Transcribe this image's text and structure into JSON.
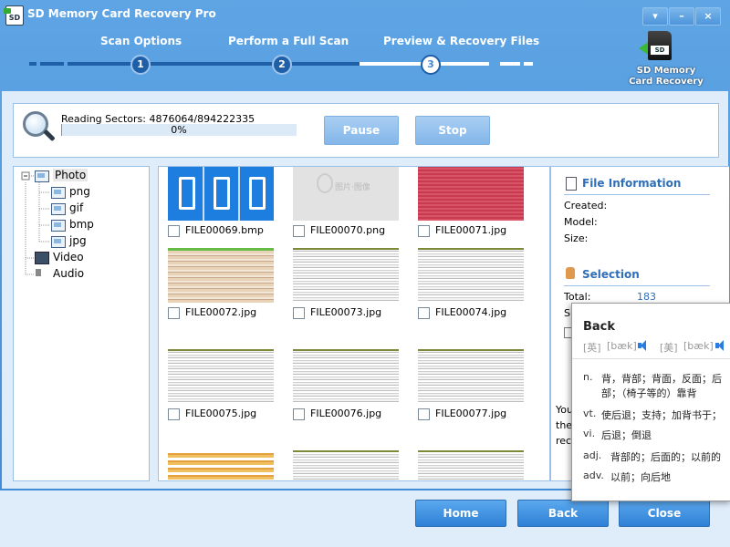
{
  "window": {
    "title": "SD Memory Card Recovery Pro",
    "controls": {
      "menu": "▾",
      "minimize": "–",
      "close": "×"
    }
  },
  "steps": [
    {
      "label": "Scan Options",
      "number": "1",
      "state": "done"
    },
    {
      "label": "Perform a Full Scan",
      "number": "2",
      "state": "done"
    },
    {
      "label": "Preview & Recovery Files",
      "number": "3",
      "state": "current"
    }
  ],
  "logo": {
    "line1": "SD Memory",
    "line2": "Card Recovery",
    "card_label": "SD"
  },
  "scan": {
    "reading_label": "Reading Sectors: 4876064/894222335",
    "progress_text": "0%",
    "progress_fraction": 0.005,
    "pause_label": "Pause",
    "stop_label": "Stop"
  },
  "tree": {
    "photo": "Photo",
    "png": "png",
    "gif": "gif",
    "bmp": "bmp",
    "jpg": "jpg",
    "video": "Video",
    "audio": "Audio"
  },
  "files": [
    {
      "name": "FILE00069.bmp",
      "kind": "bmp-blue"
    },
    {
      "name": "FILE00070.png",
      "kind": "png-gray"
    },
    {
      "name": "FILE00071.jpg",
      "kind": "jpg-red"
    },
    {
      "name": "FILE00072.jpg",
      "kind": "jpg-beige"
    },
    {
      "name": "FILE00073.jpg",
      "kind": "jpg-lines"
    },
    {
      "name": "FILE00074.jpg",
      "kind": "jpg-lines"
    },
    {
      "name": "FILE00075.jpg",
      "kind": "jpg-lines"
    },
    {
      "name": "FILE00076.jpg",
      "kind": "jpg-lines"
    },
    {
      "name": "FILE00077.jpg",
      "kind": "jpg-lines"
    },
    {
      "name": "",
      "kind": "jpg-yellow"
    },
    {
      "name": "",
      "kind": "jpg-lines"
    },
    {
      "name": "",
      "kind": "jpg-lines"
    }
  ],
  "info": {
    "file_info_title": "File Information",
    "created_label": "Created:",
    "model_label": "Model:",
    "size_label": "Size:",
    "selection_title": "Selection",
    "total_label": "Total:",
    "total_value": "183",
    "s_label": "S",
    "footer_line1": "You",
    "footer_line2": "the",
    "footer_line3": "rec"
  },
  "bottom": {
    "home": "Home",
    "back": "Back",
    "close": "Close"
  },
  "dictionary": {
    "word": "Back",
    "uk_tag": "[英]",
    "uk_phon": "[bæk]",
    "us_tag": "[美]",
    "us_phon": "[bæk]",
    "entries": [
      {
        "pos": "n.",
        "def": "背，背部；背面，反面；后",
        "def2": "部；（椅子等的）靠背"
      },
      {
        "pos": "vt.",
        "def": "使后退；支持；加背书于；",
        "def2": ""
      },
      {
        "pos": "vi.",
        "def": "后退；倒退",
        "def2": ""
      },
      {
        "pos": "adj.",
        "def": "背部的；后面的；以前的",
        "def2": ""
      },
      {
        "pos": "adv.",
        "def": "以前；向后地",
        "def2": ""
      }
    ]
  },
  "colors": {
    "accent": "#3f8ad6",
    "panel": "#dfecfa",
    "link_blue": "#2f6fb8"
  }
}
